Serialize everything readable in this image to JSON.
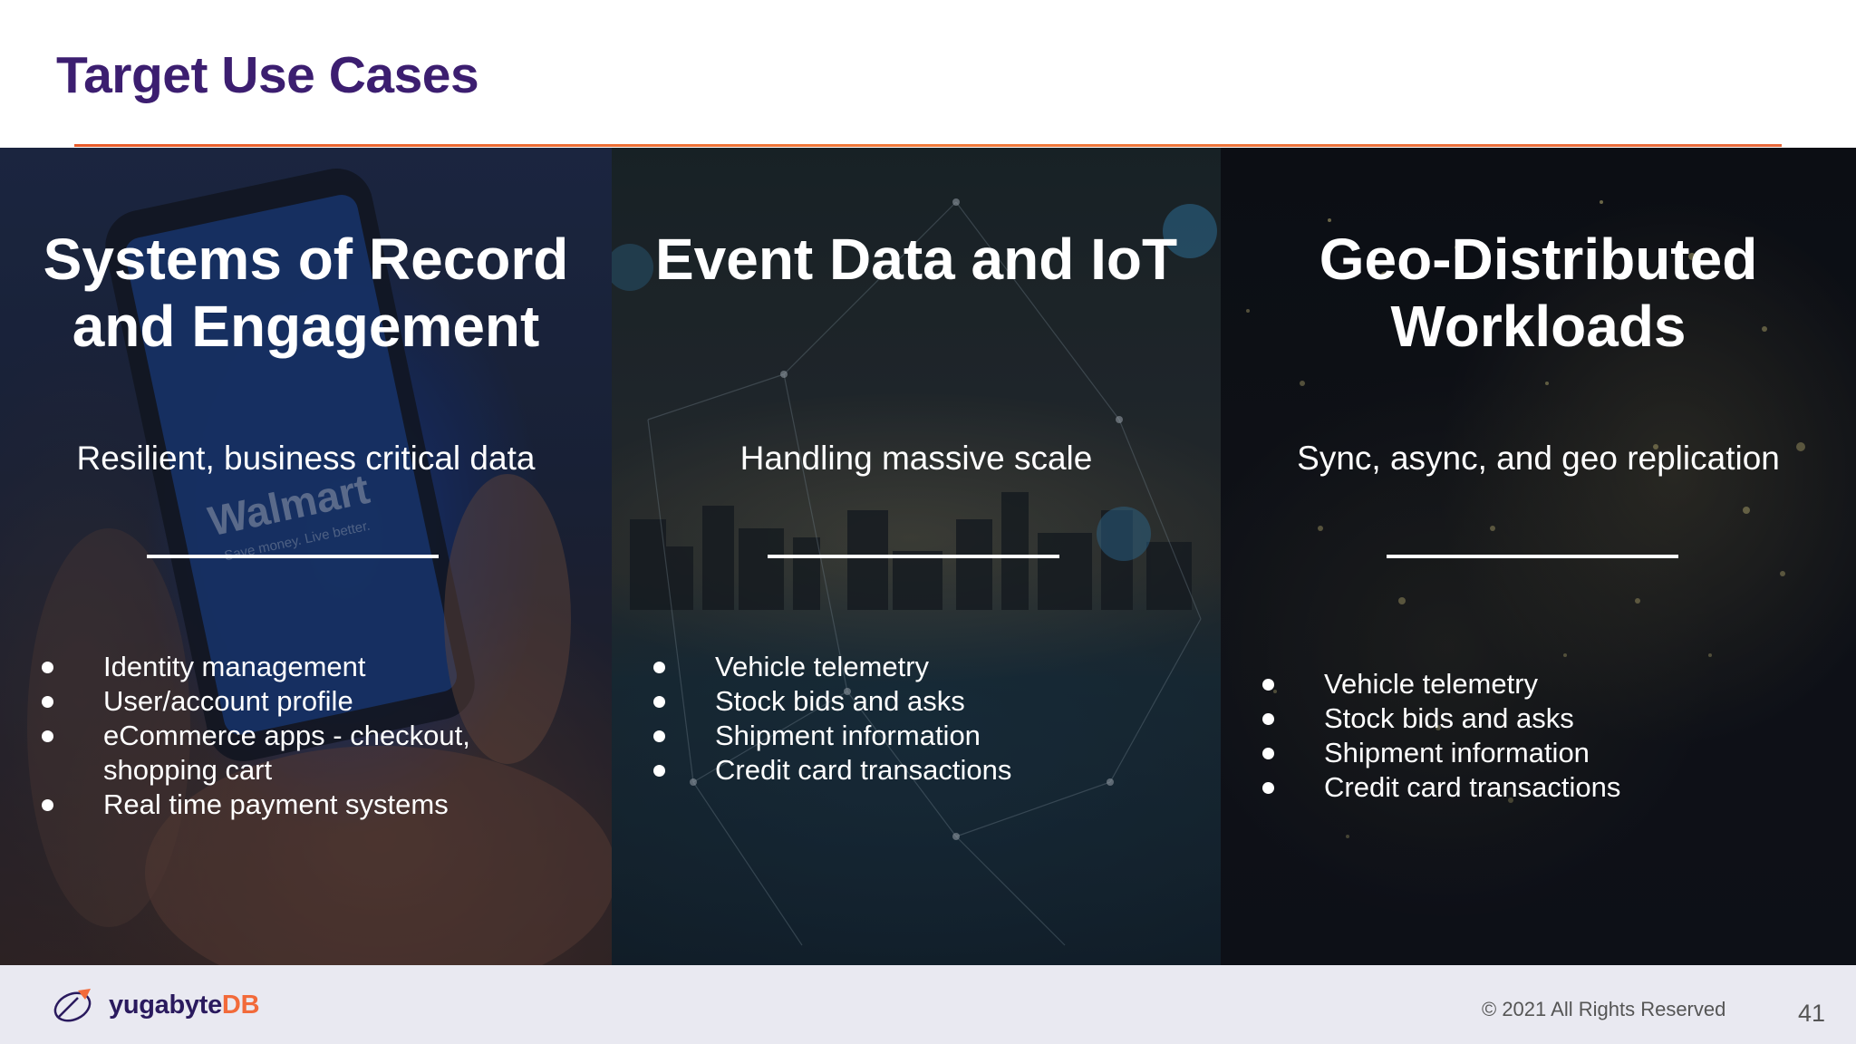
{
  "slide": {
    "title": "Target Use Cases",
    "accent_color": "#3c1e70",
    "rule_color": "#e85a2a"
  },
  "panels": [
    {
      "heading_line1": "Systems of Record",
      "heading_line2": "and Engagement",
      "subtitle": "Resilient, business critical data",
      "bullets": [
        "Identity management",
        "User/account profile",
        "eCommerce apps - checkout, shopping cart",
        "Real time payment systems"
      ],
      "background_image": "phone-in-hand-walmart-app"
    },
    {
      "heading_line1": "Event Data and IoT",
      "heading_line2": "",
      "subtitle": "Handling massive scale",
      "bullets": [
        "Vehicle telemetry",
        "Stock bids and asks",
        "Shipment information",
        "Credit card transactions"
      ],
      "background_image": "city-skyline-network"
    },
    {
      "heading_line1": "Geo-Distributed",
      "heading_line2": "Workloads",
      "subtitle": "Sync, async, and geo replication",
      "bullets": [
        "Vehicle telemetry",
        "Stock bids and asks",
        "Shipment information",
        "Credit card transactions"
      ],
      "background_image": "night-satellite-map"
    }
  ],
  "footer": {
    "logo_text_main": "yugabyte",
    "logo_text_accent": "DB",
    "copyright": "© 2021 All Rights Reserved",
    "page_number": "41"
  }
}
